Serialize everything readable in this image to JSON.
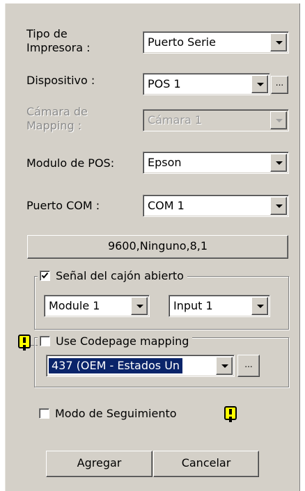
{
  "form": {
    "printer_type": {
      "label": "Tipo de\nImpresora :",
      "value": "Puerto Serie"
    },
    "device": {
      "label": "Dispositivo :",
      "value": "POS 1",
      "browse": "..."
    },
    "camera": {
      "label": "Cámara de\nMapping :",
      "value": "Cámara 1",
      "enabled": false
    },
    "pos_module": {
      "label": "Modulo de POS:",
      "value": "Epson"
    },
    "com_port": {
      "label": "Puerto COM :",
      "value": "COM 1"
    },
    "serial_settings_button": "9600,Ninguno,8,1"
  },
  "drawer_group": {
    "checkbox_label": "Señal del cajón abierto",
    "checked": true,
    "module_value": "Module 1",
    "input_value": "Input 1"
  },
  "codepage_group": {
    "checkbox_label": "Use Codepage mapping",
    "checked": false,
    "codepage_value": "437   (OEM - Estados Un",
    "browse": "..."
  },
  "tracking": {
    "checkbox_label": "Modo de Seguimiento",
    "checked": false
  },
  "buttons": {
    "add": "Agregar",
    "cancel": "Cancelar"
  },
  "colors": {
    "dialog_bg": "#d4d0c8",
    "selection": "#0a246a",
    "warning": "#ffff00"
  }
}
